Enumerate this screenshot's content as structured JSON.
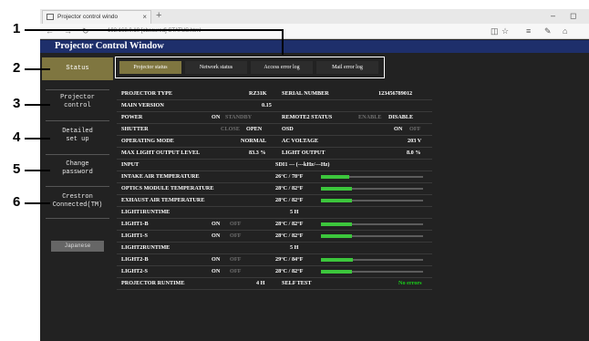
{
  "browser": {
    "tab_title": "Projector control windo",
    "tab_close": "×",
    "new_tab": "+",
    "url": "192.168.0.10 [obscured] STATUS.html",
    "nav_back": "←",
    "nav_forward": "→",
    "nav_refresh": "↻",
    "window_controls": [
      "–",
      "◻"
    ],
    "addr_icons": [
      "◫",
      "☆",
      "≡",
      "✎",
      "⌂"
    ]
  },
  "page": {
    "title": "Projector Control Window"
  },
  "sidebar": {
    "items": [
      {
        "label": "Status",
        "active": true
      },
      {
        "label": "Projector\ncontrol",
        "active": false
      },
      {
        "label": "Detailed\nset up",
        "active": false
      },
      {
        "label": "Change\npassword",
        "active": false
      },
      {
        "label": "Crestron\nConnected(TM)",
        "active": false
      }
    ],
    "language_button": "Japanese"
  },
  "subtabs": [
    {
      "label": "Projector status",
      "active": true
    },
    {
      "label": "Network status",
      "active": false
    },
    {
      "label": "Access error log",
      "active": false
    },
    {
      "label": "Mail error log",
      "active": false
    }
  ],
  "callouts": [
    "1",
    "2",
    "3",
    "4",
    "5",
    "6"
  ],
  "status": {
    "projector_type_label": "PROJECTOR TYPE",
    "projector_type_value": "RZ31K",
    "serial_number_label": "SERIAL NUMBER",
    "serial_number_value": "123456789012",
    "main_version_label": "MAIN VERSION",
    "main_version_value": "0.15",
    "power_label": "POWER",
    "power_on": "ON",
    "power_standby": "STANDBY",
    "remote2_label": "REMOTE2 STATUS",
    "remote2_enable": "ENABLE",
    "remote2_disable": "DISABLE",
    "shutter_label": "SHUTTER",
    "shutter_close": "CLOSE",
    "shutter_open": "OPEN",
    "osd_label": "OSD",
    "osd_on": "ON",
    "osd_off": "OFF",
    "operating_mode_label": "OPERATING MODE",
    "operating_mode_value": "NORMAL",
    "ac_voltage_label": "AC VOLTAGE",
    "ac_voltage_value": "203 V",
    "max_light_label": "MAX LIGHT OUTPUT LEVEL",
    "max_light_value": "83.3 %",
    "light_output_label": "LIGHT OUTPUT",
    "light_output_value": "8.0 %",
    "input_label": "INPUT",
    "input_value": "SDI1   --- (---kHz/---Hz)",
    "intake_temp_label": "INTAKE AIR TEMPERATURE",
    "intake_temp_value": "26°C / 78°F",
    "intake_temp_level": 0.28,
    "optics_temp_label": "OPTICS MODULE TEMPERATURE",
    "optics_temp_value": "28°C / 82°F",
    "optics_temp_level": 0.3,
    "exhaust_temp_label": "EXHAUST AIR TEMPERATURE",
    "exhaust_temp_value": "28°C / 82°F",
    "exhaust_temp_level": 0.3,
    "light1_runtime_label": "LIGHT1RUNTIME",
    "light1_runtime_value": "5 H",
    "light1b_label": "LIGHT1-B",
    "light1b_on": "ON",
    "light1b_off": "OFF",
    "light1b_temp": "28°C / 82°F",
    "light1b_level": 0.3,
    "light1s_label": "LIGHT1-S",
    "light1s_on": "ON",
    "light1s_off": "OFF",
    "light1s_temp": "28°C / 82°F",
    "light1s_level": 0.3,
    "light2_runtime_label": "LIGHT2RUNTIME",
    "light2_runtime_value": "5 H",
    "light2b_label": "LIGHT2-B",
    "light2b_on": "ON",
    "light2b_off": "OFF",
    "light2b_temp": "29°C / 84°F",
    "light2b_level": 0.31,
    "light2s_label": "LIGHT2-S",
    "light2s_on": "ON",
    "light2s_off": "OFF",
    "light2s_temp": "28°C / 82°F",
    "light2s_level": 0.3,
    "projector_runtime_label": "PROJECTOR RUNTIME",
    "projector_runtime_value": "4 H",
    "self_test_label": "SELF TEST",
    "self_test_value": "No errors"
  },
  "colors": {
    "page_background": "#222222",
    "title_bar": "#1e2f6b",
    "active_tab": "#7f7640",
    "bar_fill": "#3cc63c",
    "ok_text": "#19d119"
  }
}
